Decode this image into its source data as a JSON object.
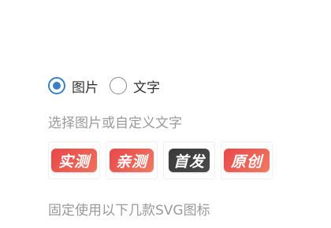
{
  "colors": {
    "accent": "#3b7fc4",
    "hint_text": "#9a9a9a",
    "label_text": "#333333"
  },
  "source_type": {
    "options": [
      {
        "label": "图片",
        "selected": true
      },
      {
        "label": "文字",
        "selected": false
      }
    ]
  },
  "hint": "选择图片或自定义文字",
  "badges": [
    {
      "text": "实测",
      "background": "#e8474a",
      "gradient_to": "#f07058"
    },
    {
      "text": "亲测",
      "background": "#e8474a",
      "gradient_to": "#f07a62"
    },
    {
      "text": "首发",
      "background": "#3a3a3a",
      "gradient_to": "#4a4a4a"
    },
    {
      "text": "原创",
      "background": "#e8474a",
      "gradient_to": "#f07a62"
    }
  ],
  "footer_note": "固定使用以下几款SVG图标"
}
